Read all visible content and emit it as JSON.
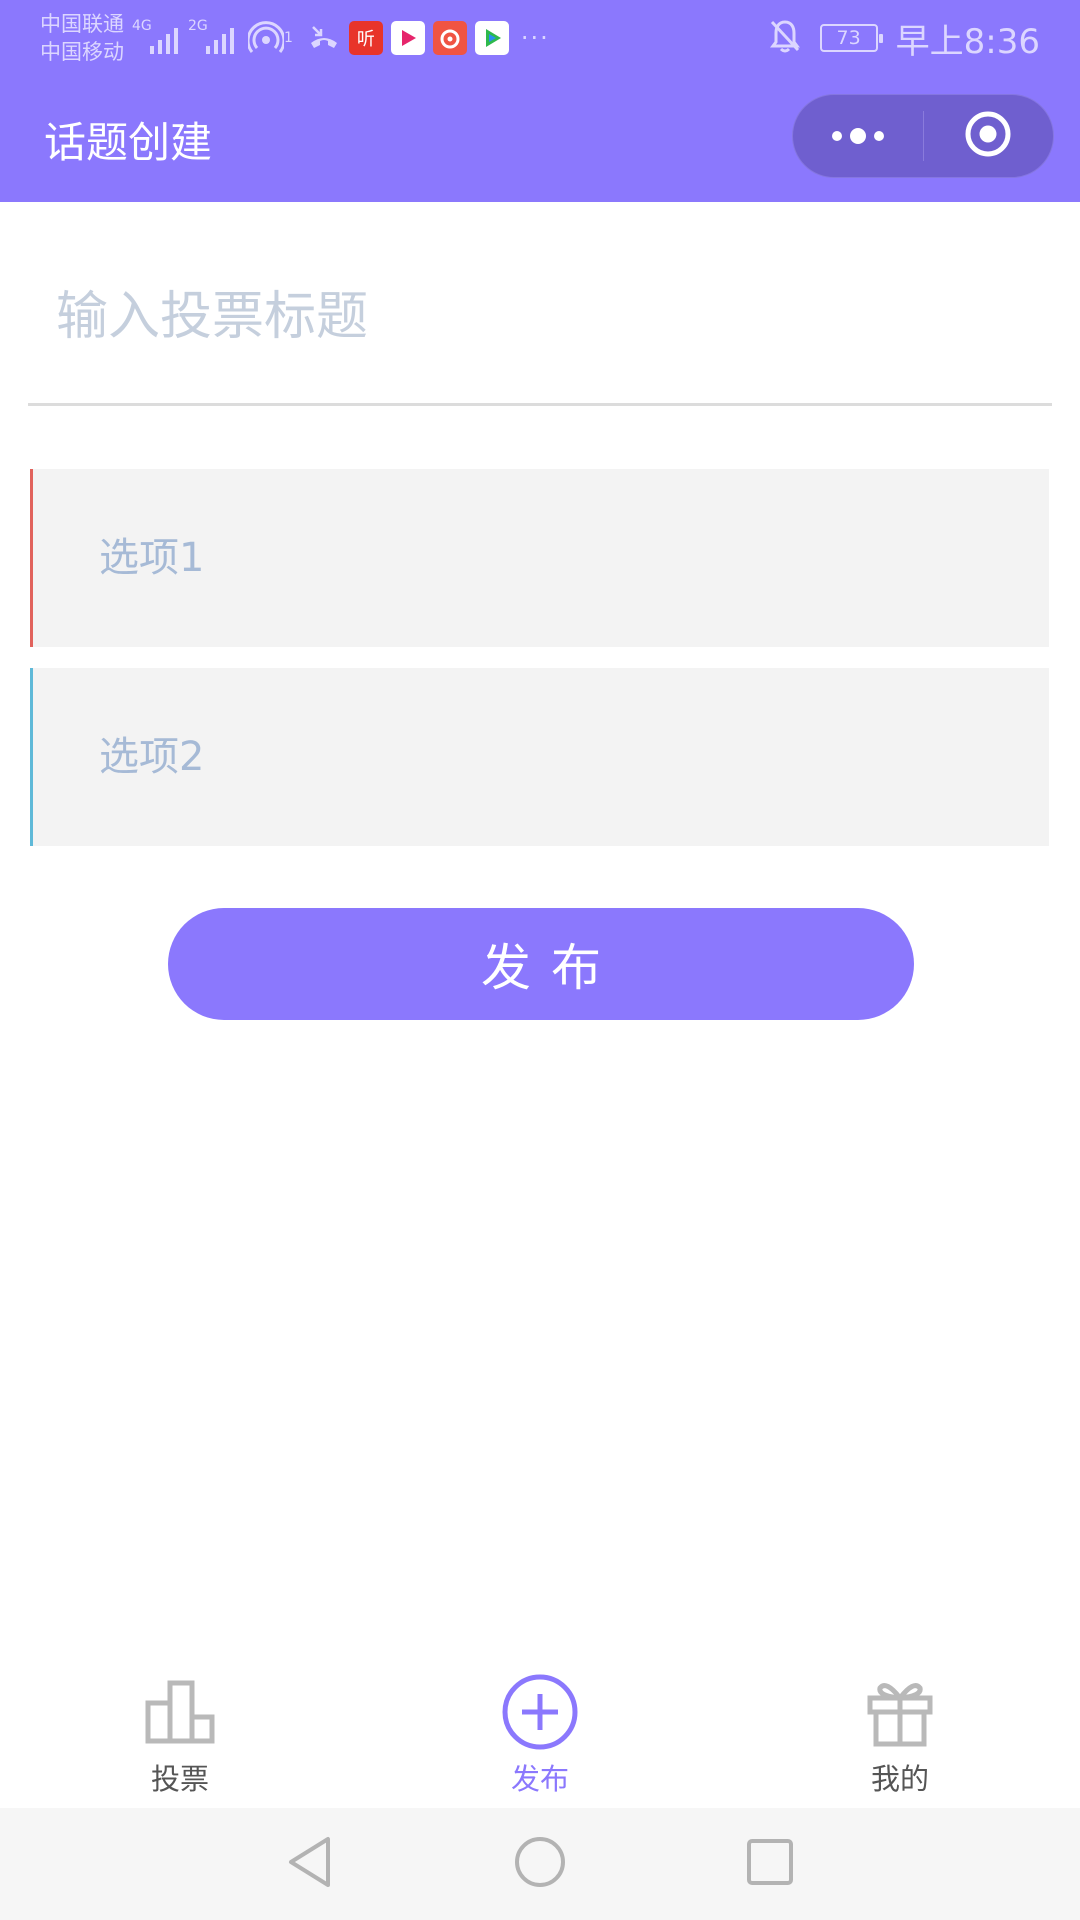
{
  "status_bar": {
    "carrier_1": "中国联通",
    "carrier_2": "中国移动",
    "signal_1_tag": "4G",
    "signal_2_tag": "2G",
    "hotspot_badge": "1",
    "app_tile_label": "听",
    "more": "···",
    "battery": "73",
    "time": "早上8:36",
    "accent_color": "#8b78fd"
  },
  "nav": {
    "title": "话题创建",
    "more_icon": "more-dots-icon",
    "close_icon": "target-circle-icon"
  },
  "form": {
    "title_placeholder": "输入投票标题",
    "title_value": "",
    "options": [
      {
        "placeholder": "选项1",
        "value": "",
        "accent": "#e1625c"
      },
      {
        "placeholder": "选项2",
        "value": "",
        "accent": "#5fb9d8"
      }
    ],
    "publish_label": "发布"
  },
  "tabs": [
    {
      "label": "投票",
      "icon": "bar-chart-icon",
      "active": false
    },
    {
      "label": "发布",
      "icon": "plus-circle-icon",
      "active": true
    },
    {
      "label": "我的",
      "icon": "gift-icon",
      "active": false
    }
  ],
  "system_nav": {
    "back_icon": "triangle-back-icon",
    "home_icon": "circle-home-icon",
    "recents_icon": "square-recents-icon"
  }
}
